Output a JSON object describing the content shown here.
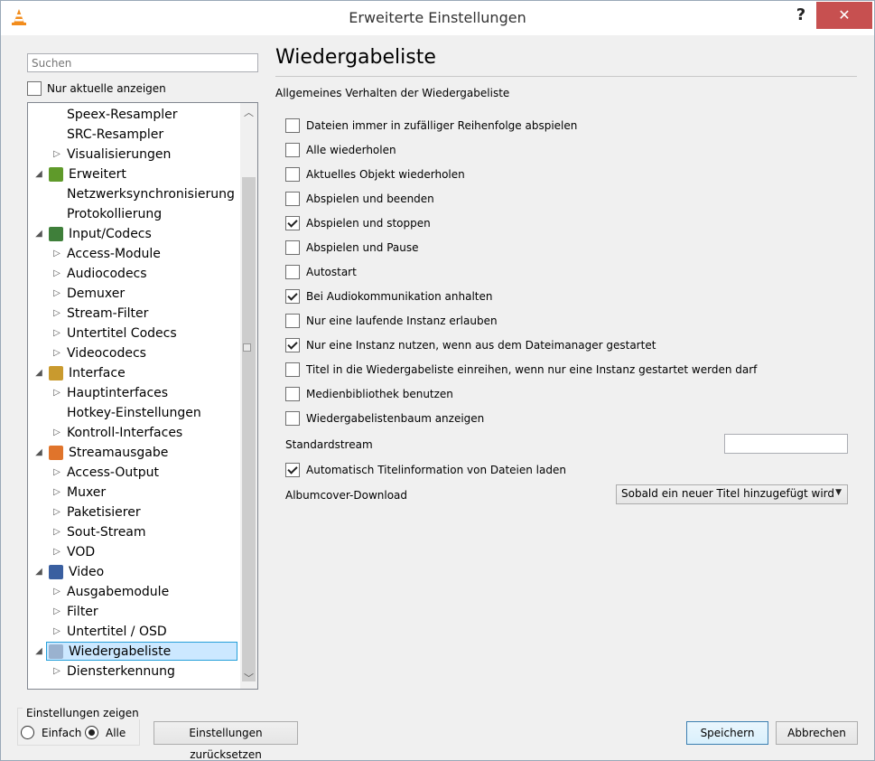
{
  "window": {
    "title": "Erweiterte Einstellungen",
    "help_label": "?",
    "close_label": "✕"
  },
  "sidebar": {
    "search_placeholder": "Suchen",
    "only_current_label": "Nur aktuelle anzeigen",
    "only_current_checked": false,
    "tree": [
      {
        "label": "Speex-Resampler",
        "level": 2,
        "arrow": ""
      },
      {
        "label": "SRC-Resampler",
        "level": 2,
        "arrow": ""
      },
      {
        "label": "Visualisierungen",
        "level": 2,
        "arrow": "▷"
      },
      {
        "label": "Erweitert",
        "level": 1,
        "arrow": "◢",
        "icon": "chip-icon"
      },
      {
        "label": "Netzwerksynchronisierung",
        "level": 2,
        "arrow": ""
      },
      {
        "label": "Protokollierung",
        "level": 2,
        "arrow": ""
      },
      {
        "label": "Input/Codecs",
        "level": 1,
        "arrow": "◢",
        "icon": "codecs-icon"
      },
      {
        "label": "Access-Module",
        "level": 2,
        "arrow": "▷"
      },
      {
        "label": "Audiocodecs",
        "level": 2,
        "arrow": "▷"
      },
      {
        "label": "Demuxer",
        "level": 2,
        "arrow": "▷"
      },
      {
        "label": "Stream-Filter",
        "level": 2,
        "arrow": "▷"
      },
      {
        "label": "Untertitel Codecs",
        "level": 2,
        "arrow": "▷"
      },
      {
        "label": "Videocodecs",
        "level": 2,
        "arrow": "▷"
      },
      {
        "label": "Interface",
        "level": 1,
        "arrow": "◢",
        "icon": "interface-icon"
      },
      {
        "label": "Hauptinterfaces",
        "level": 2,
        "arrow": "▷"
      },
      {
        "label": "Hotkey-Einstellungen",
        "level": 2,
        "arrow": ""
      },
      {
        "label": "Kontroll-Interfaces",
        "level": 2,
        "arrow": "▷"
      },
      {
        "label": "Streamausgabe",
        "level": 1,
        "arrow": "◢",
        "icon": "stream-output-icon"
      },
      {
        "label": "Access-Output",
        "level": 2,
        "arrow": "▷"
      },
      {
        "label": "Muxer",
        "level": 2,
        "arrow": "▷"
      },
      {
        "label": "Paketisierer",
        "level": 2,
        "arrow": "▷"
      },
      {
        "label": "Sout-Stream",
        "level": 2,
        "arrow": "▷"
      },
      {
        "label": "VOD",
        "level": 2,
        "arrow": "▷"
      },
      {
        "label": "Video",
        "level": 1,
        "arrow": "◢",
        "icon": "video-icon"
      },
      {
        "label": "Ausgabemodule",
        "level": 2,
        "arrow": "▷"
      },
      {
        "label": "Filter",
        "level": 2,
        "arrow": "▷"
      },
      {
        "label": "Untertitel / OSD",
        "level": 2,
        "arrow": "▷"
      },
      {
        "label": "Wiedergabeliste",
        "level": 1,
        "arrow": "◢",
        "icon": "playlist-icon",
        "selected": true
      },
      {
        "label": "Diensterkennung",
        "level": 2,
        "arrow": "▷"
      }
    ]
  },
  "main": {
    "heading": "Wiedergabeliste",
    "section_title": "Allgemeines Verhalten der Wiedergabeliste",
    "options": [
      {
        "label": "Dateien immer in zufälliger Reihenfolge abspielen",
        "checked": false
      },
      {
        "label": "Alle wiederholen",
        "checked": false
      },
      {
        "label": "Aktuelles Objekt wiederholen",
        "checked": false
      },
      {
        "label": "Abspielen und beenden",
        "checked": false
      },
      {
        "label": "Abspielen und stoppen",
        "checked": true
      },
      {
        "label": "Abspielen und Pause",
        "checked": false
      },
      {
        "label": "Autostart",
        "checked": false
      },
      {
        "label": "Bei Audiokommunikation anhalten",
        "checked": true
      },
      {
        "label": "Nur eine laufende Instanz erlauben",
        "checked": false
      },
      {
        "label": "Nur eine Instanz nutzen, wenn aus dem Dateimanager gestartet",
        "checked": true
      },
      {
        "label": "Titel in die Wiedergabeliste einreihen, wenn nur eine Instanz gestartet werden darf",
        "checked": false
      },
      {
        "label": "Medienbibliothek benutzen",
        "checked": false
      },
      {
        "label": "Wiedergabelistenbaum anzeigen",
        "checked": false
      }
    ],
    "standard_stream_label": "Standardstream",
    "standard_stream_value": "",
    "auto_title_label": "Automatisch Titelinformation von Dateien laden",
    "auto_title_checked": true,
    "album_cover_label": "Albumcover-Download",
    "album_cover_value": "Sobald ein neuer Titel hinzugefügt wird"
  },
  "footer": {
    "mode_caption": "Einstellungen zeigen",
    "mode_simple": "Einfach",
    "mode_all": "Alle",
    "mode_selected": "Alle",
    "reset_label": "Einstellungen zurücksetzen",
    "save_label": "Speichern",
    "cancel_label": "Abbrechen"
  },
  "colors": {
    "selection_bg": "#cce8ff",
    "selection_border": "#26a0da",
    "close_button": "#c75050"
  }
}
